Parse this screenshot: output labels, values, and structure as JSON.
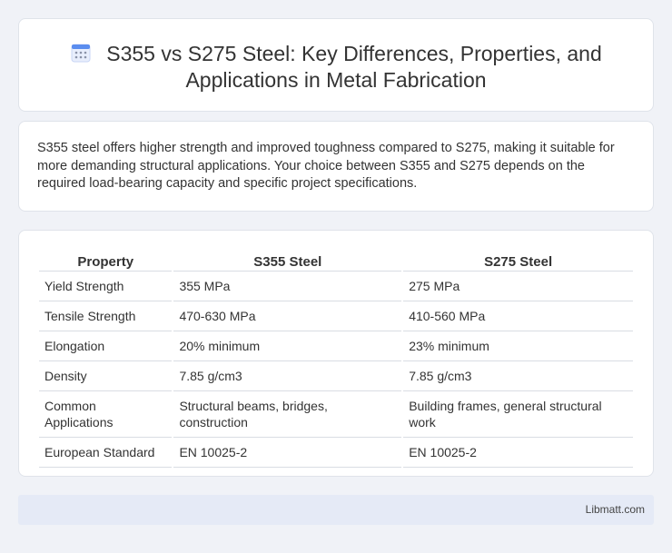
{
  "header": {
    "icon": "calendar-icon",
    "title_line1": "S355 vs S275 Steel: Key Differences, Properties, and",
    "title_line2": "Applications in Metal Fabrication"
  },
  "intro": {
    "text": "S355 steel offers higher strength and improved toughness compared to S275, making it suitable for more demanding structural applications. Your choice between S355 and S275 depends on the required load-bearing capacity and specific project specifications."
  },
  "table": {
    "headers": [
      "Property",
      "S355 Steel",
      "S275 Steel"
    ],
    "rows": [
      [
        "Yield Strength",
        "355 MPa",
        "275 MPa"
      ],
      [
        "Tensile Strength",
        "470-630 MPa",
        "410-560 MPa"
      ],
      [
        "Elongation",
        "20% minimum",
        "23% minimum"
      ],
      [
        "Density",
        "7.85 g/cm3",
        "7.85 g/cm3"
      ],
      [
        "Common Applications",
        "Structural beams, bridges, construction",
        "Building frames, general structural work"
      ],
      [
        "European Standard",
        "EN 10025-2",
        "EN 10025-2"
      ]
    ]
  },
  "footer": {
    "site": "Libmatt.com"
  },
  "colors": {
    "background": "#f0f2f7",
    "card": "#ffffff",
    "footer_bg": "#e5eaf6",
    "icon_blue": "#5b8def"
  }
}
